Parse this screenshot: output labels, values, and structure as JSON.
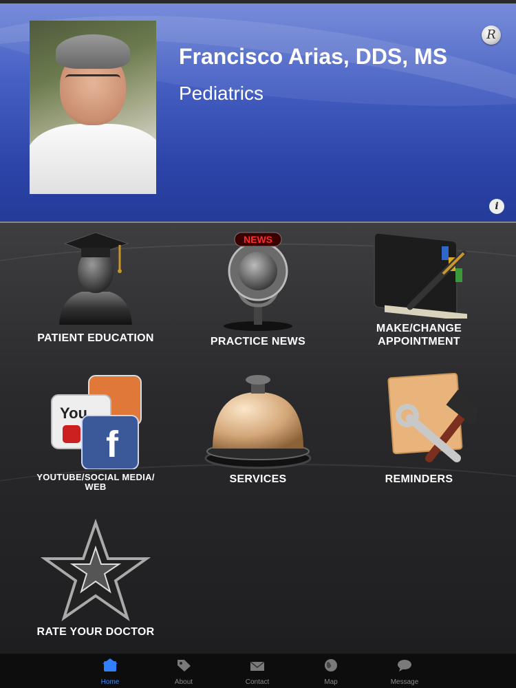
{
  "header": {
    "doctor_name": "Francisco Arias, DDS, MS",
    "specialty": "Pediatrics",
    "r_button": "R",
    "info_button": "i"
  },
  "menu": {
    "patient_education": "PATIENT EDUCATION",
    "practice_news": "PRACTICE NEWS",
    "appointment_line1": "MAKE/CHANGE",
    "appointment_line2": "APPOINTMENT",
    "social_line1": "YOUTUBE/SOCIAL MEDIA/",
    "social_line2": "WEB",
    "services": "SERVICES",
    "reminders": "REMINDERS",
    "rate_doctor": "RATE YOUR DOCTOR",
    "news_sign": "NEWS",
    "youtube_text": "You",
    "facebook_letter": "f"
  },
  "tabs": [
    {
      "label": "Home",
      "icon": "home-icon",
      "active": true
    },
    {
      "label": "About",
      "icon": "tag-icon",
      "active": false
    },
    {
      "label": "Contact",
      "icon": "envelope-icon",
      "active": false
    },
    {
      "label": "Map",
      "icon": "globe-icon",
      "active": false
    },
    {
      "label": "Message",
      "icon": "chat-bubble-icon",
      "active": false
    }
  ],
  "colors": {
    "header_blue": "#2c44a8",
    "active_tab": "#3a8cff",
    "background": "#1b1b1d"
  }
}
